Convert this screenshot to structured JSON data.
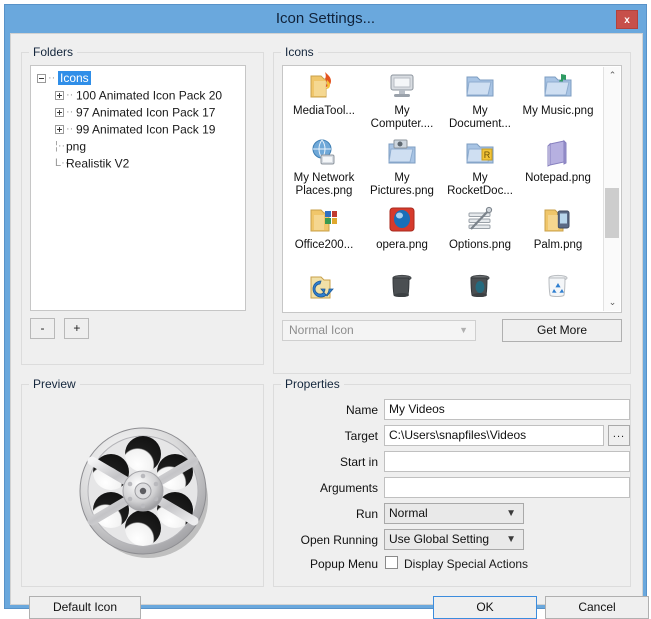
{
  "window": {
    "title": "Icon Settings...",
    "close_label": "x",
    "accent_color": "#6aa8dd",
    "close_color": "#c7504a",
    "body_color": "#efefef"
  },
  "folders": {
    "group_label": "Folders",
    "tree": [
      {
        "label": "Icons",
        "toggle": "minus",
        "level": 1,
        "selected": true
      },
      {
        "label": "100 Animated Icon Pack  20",
        "toggle": "plus",
        "level": 2,
        "selected": false
      },
      {
        "label": "97 Animated Icon Pack  17",
        "toggle": "plus",
        "level": 2,
        "selected": false
      },
      {
        "label": "99 Animated Icon Pack  19",
        "toggle": "plus",
        "level": 2,
        "selected": false
      },
      {
        "label": "png",
        "toggle": "none",
        "level": 2,
        "selected": false
      },
      {
        "label": "Realistik V2",
        "toggle": "none",
        "level": 2,
        "selected": false
      }
    ],
    "remove_button": "-",
    "add_button": "+"
  },
  "preview": {
    "group_label": "Preview",
    "icon_name": "film-reel-icon"
  },
  "icons": {
    "group_label": "Icons",
    "items": [
      {
        "label": "MediaTool...",
        "icon": "folder-flame-icon"
      },
      {
        "label": "My Computer....",
        "icon": "monitor-icon"
      },
      {
        "label": "My Document...",
        "icon": "folder-documents-icon"
      },
      {
        "label": "My Music.png",
        "icon": "folder-music-icon"
      },
      {
        "label": "My Network Places.png",
        "icon": "network-globe-icon"
      },
      {
        "label": "My Pictures.png",
        "icon": "folder-pictures-icon"
      },
      {
        "label": "My RocketDoc...",
        "icon": "folder-rocketdock-icon"
      },
      {
        "label": "Notepad.png",
        "icon": "notepad-icon"
      },
      {
        "label": "Office200...",
        "icon": "folder-office-icon"
      },
      {
        "label": "opera.png",
        "icon": "opera-icon"
      },
      {
        "label": "Options.png",
        "icon": "options-sliders-icon"
      },
      {
        "label": "Palm.png",
        "icon": "folder-palm-icon"
      },
      {
        "label": "",
        "icon": "folder-refresh-icon"
      },
      {
        "label": "",
        "icon": "trash-dark-icon"
      },
      {
        "label": "",
        "icon": "trash-teal-icon"
      },
      {
        "label": "",
        "icon": "recycle-bin-icon"
      }
    ],
    "type_select_value": "Normal Icon",
    "get_more_label": "Get More",
    "scrollbar": {
      "up": "⌃",
      "down": "⌄"
    }
  },
  "properties": {
    "group_label": "Properties",
    "name": {
      "label": "Name",
      "value": "My Videos"
    },
    "target": {
      "label": "Target",
      "value": "C:\\Users\\snapfiles\\Videos",
      "browse_label": "..."
    },
    "start_in": {
      "label": "Start in",
      "value": ""
    },
    "arguments": {
      "label": "Arguments",
      "value": ""
    },
    "run": {
      "label": "Run",
      "value": "Normal"
    },
    "open_running": {
      "label": "Open Running",
      "value": "Use Global Setting"
    },
    "popup_menu": {
      "label": "Popup Menu",
      "checkbox_label": "Display Special Actions",
      "checked": false
    }
  },
  "footer": {
    "default_icon": "Default Icon",
    "ok": "OK",
    "cancel": "Cancel"
  }
}
